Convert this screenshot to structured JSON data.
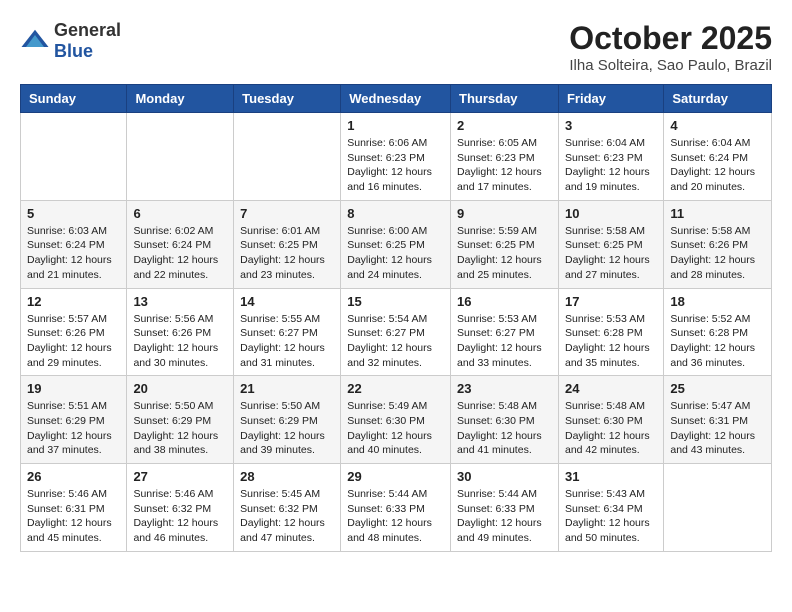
{
  "header": {
    "logo_general": "General",
    "logo_blue": "Blue",
    "month": "October 2025",
    "location": "Ilha Solteira, Sao Paulo, Brazil"
  },
  "days_of_week": [
    "Sunday",
    "Monday",
    "Tuesday",
    "Wednesday",
    "Thursday",
    "Friday",
    "Saturday"
  ],
  "weeks": [
    [
      {
        "day": "",
        "info": ""
      },
      {
        "day": "",
        "info": ""
      },
      {
        "day": "",
        "info": ""
      },
      {
        "day": "1",
        "info": "Sunrise: 6:06 AM\nSunset: 6:23 PM\nDaylight: 12 hours\nand 16 minutes."
      },
      {
        "day": "2",
        "info": "Sunrise: 6:05 AM\nSunset: 6:23 PM\nDaylight: 12 hours\nand 17 minutes."
      },
      {
        "day": "3",
        "info": "Sunrise: 6:04 AM\nSunset: 6:23 PM\nDaylight: 12 hours\nand 19 minutes."
      },
      {
        "day": "4",
        "info": "Sunrise: 6:04 AM\nSunset: 6:24 PM\nDaylight: 12 hours\nand 20 minutes."
      }
    ],
    [
      {
        "day": "5",
        "info": "Sunrise: 6:03 AM\nSunset: 6:24 PM\nDaylight: 12 hours\nand 21 minutes."
      },
      {
        "day": "6",
        "info": "Sunrise: 6:02 AM\nSunset: 6:24 PM\nDaylight: 12 hours\nand 22 minutes."
      },
      {
        "day": "7",
        "info": "Sunrise: 6:01 AM\nSunset: 6:25 PM\nDaylight: 12 hours\nand 23 minutes."
      },
      {
        "day": "8",
        "info": "Sunrise: 6:00 AM\nSunset: 6:25 PM\nDaylight: 12 hours\nand 24 minutes."
      },
      {
        "day": "9",
        "info": "Sunrise: 5:59 AM\nSunset: 6:25 PM\nDaylight: 12 hours\nand 25 minutes."
      },
      {
        "day": "10",
        "info": "Sunrise: 5:58 AM\nSunset: 6:25 PM\nDaylight: 12 hours\nand 27 minutes."
      },
      {
        "day": "11",
        "info": "Sunrise: 5:58 AM\nSunset: 6:26 PM\nDaylight: 12 hours\nand 28 minutes."
      }
    ],
    [
      {
        "day": "12",
        "info": "Sunrise: 5:57 AM\nSunset: 6:26 PM\nDaylight: 12 hours\nand 29 minutes."
      },
      {
        "day": "13",
        "info": "Sunrise: 5:56 AM\nSunset: 6:26 PM\nDaylight: 12 hours\nand 30 minutes."
      },
      {
        "day": "14",
        "info": "Sunrise: 5:55 AM\nSunset: 6:27 PM\nDaylight: 12 hours\nand 31 minutes."
      },
      {
        "day": "15",
        "info": "Sunrise: 5:54 AM\nSunset: 6:27 PM\nDaylight: 12 hours\nand 32 minutes."
      },
      {
        "day": "16",
        "info": "Sunrise: 5:53 AM\nSunset: 6:27 PM\nDaylight: 12 hours\nand 33 minutes."
      },
      {
        "day": "17",
        "info": "Sunrise: 5:53 AM\nSunset: 6:28 PM\nDaylight: 12 hours\nand 35 minutes."
      },
      {
        "day": "18",
        "info": "Sunrise: 5:52 AM\nSunset: 6:28 PM\nDaylight: 12 hours\nand 36 minutes."
      }
    ],
    [
      {
        "day": "19",
        "info": "Sunrise: 5:51 AM\nSunset: 6:29 PM\nDaylight: 12 hours\nand 37 minutes."
      },
      {
        "day": "20",
        "info": "Sunrise: 5:50 AM\nSunset: 6:29 PM\nDaylight: 12 hours\nand 38 minutes."
      },
      {
        "day": "21",
        "info": "Sunrise: 5:50 AM\nSunset: 6:29 PM\nDaylight: 12 hours\nand 39 minutes."
      },
      {
        "day": "22",
        "info": "Sunrise: 5:49 AM\nSunset: 6:30 PM\nDaylight: 12 hours\nand 40 minutes."
      },
      {
        "day": "23",
        "info": "Sunrise: 5:48 AM\nSunset: 6:30 PM\nDaylight: 12 hours\nand 41 minutes."
      },
      {
        "day": "24",
        "info": "Sunrise: 5:48 AM\nSunset: 6:30 PM\nDaylight: 12 hours\nand 42 minutes."
      },
      {
        "day": "25",
        "info": "Sunrise: 5:47 AM\nSunset: 6:31 PM\nDaylight: 12 hours\nand 43 minutes."
      }
    ],
    [
      {
        "day": "26",
        "info": "Sunrise: 5:46 AM\nSunset: 6:31 PM\nDaylight: 12 hours\nand 45 minutes."
      },
      {
        "day": "27",
        "info": "Sunrise: 5:46 AM\nSunset: 6:32 PM\nDaylight: 12 hours\nand 46 minutes."
      },
      {
        "day": "28",
        "info": "Sunrise: 5:45 AM\nSunset: 6:32 PM\nDaylight: 12 hours\nand 47 minutes."
      },
      {
        "day": "29",
        "info": "Sunrise: 5:44 AM\nSunset: 6:33 PM\nDaylight: 12 hours\nand 48 minutes."
      },
      {
        "day": "30",
        "info": "Sunrise: 5:44 AM\nSunset: 6:33 PM\nDaylight: 12 hours\nand 49 minutes."
      },
      {
        "day": "31",
        "info": "Sunrise: 5:43 AM\nSunset: 6:34 PM\nDaylight: 12 hours\nand 50 minutes."
      },
      {
        "day": "",
        "info": ""
      }
    ]
  ]
}
